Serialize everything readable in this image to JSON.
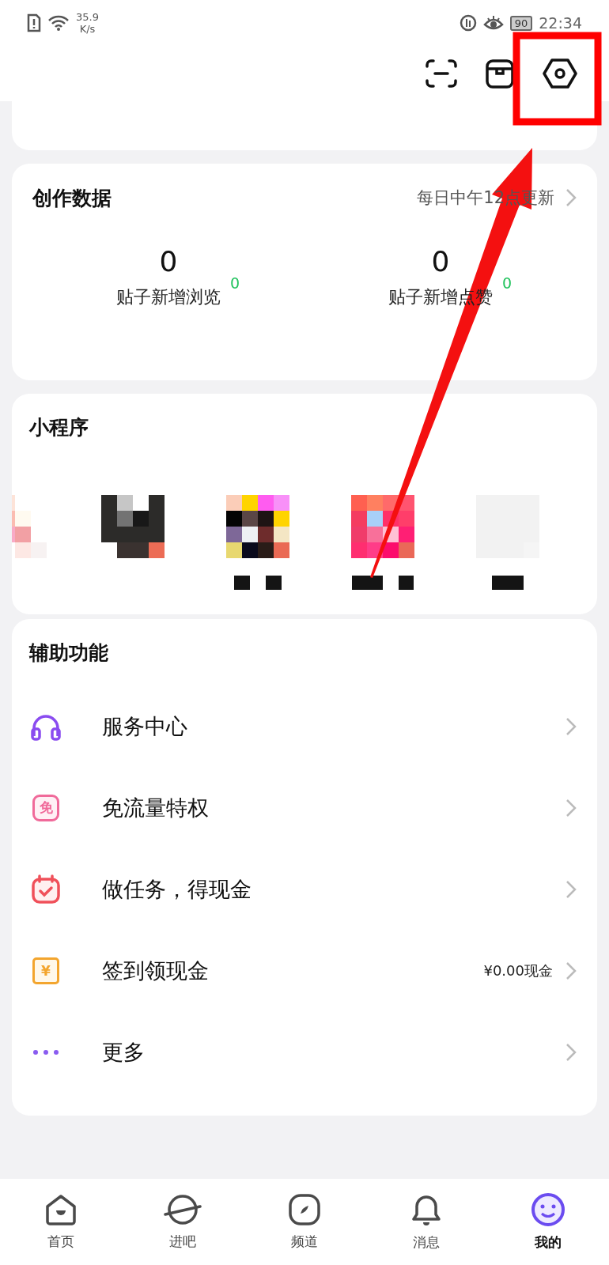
{
  "status_bar": {
    "speed": "35.9",
    "speed_unit": "K/s",
    "battery": "90",
    "time": "22:34"
  },
  "creation_data": {
    "title": "创作数据",
    "update_note": "每日中午12点更新",
    "stats": [
      {
        "value": "0",
        "delta": "0",
        "label": "贴子新增浏览"
      },
      {
        "value": "0",
        "delta": "0",
        "label": "贴子新增点赞"
      }
    ]
  },
  "mini_programs": {
    "title": "小程序"
  },
  "assist": {
    "title": "辅助功能",
    "items": [
      {
        "kind": "headphones",
        "label": "服务中心"
      },
      {
        "kind": "badge",
        "icon_text": "免",
        "label": "免流量特权"
      },
      {
        "kind": "calendar",
        "label": "做任务，得现金"
      },
      {
        "kind": "coin",
        "icon_text": "¥",
        "label": "签到领现金",
        "value": "¥0.00现金"
      },
      {
        "kind": "dots",
        "label": "更多"
      }
    ]
  },
  "nav": [
    {
      "kind": "home",
      "label": "首页",
      "selected": false
    },
    {
      "kind": "planet",
      "label": "进吧",
      "selected": false
    },
    {
      "kind": "compass",
      "label": "频道",
      "selected": false
    },
    {
      "kind": "bell",
      "label": "消息",
      "selected": false
    },
    {
      "kind": "avatar",
      "label": "我的",
      "selected": true
    }
  ]
}
